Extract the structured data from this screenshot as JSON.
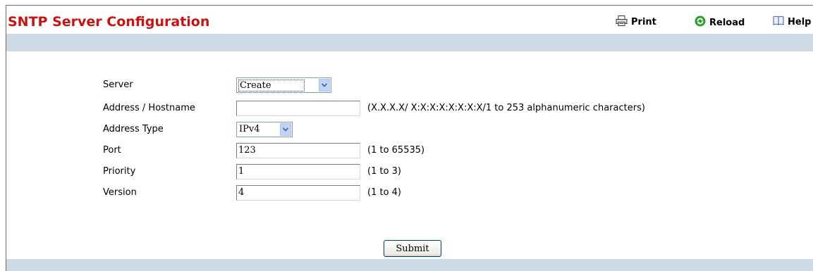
{
  "page": {
    "title": "SNTP Server Configuration"
  },
  "toolbar": {
    "print_label": "Print",
    "reload_label": "Reload",
    "help_label": "Help"
  },
  "form": {
    "server": {
      "label": "Server",
      "value": "Create"
    },
    "address": {
      "label": "Address / Hostname",
      "value": "",
      "hint": "(X.X.X.X/ X:X:X:X:X:X:X:X/1 to 253 alphanumeric characters)"
    },
    "address_type": {
      "label": "Address Type",
      "value": "IPv4"
    },
    "port": {
      "label": "Port",
      "value": "123",
      "hint": "(1 to 65535)"
    },
    "priority": {
      "label": "Priority",
      "value": "1",
      "hint": "(1 to 3)"
    },
    "version": {
      "label": "Version",
      "value": "4",
      "hint": "(1 to 4)"
    }
  },
  "actions": {
    "submit_label": "Submit"
  },
  "colors": {
    "title": "#cc1111",
    "band": "#cfdbe4",
    "reload_icon": "#2e9c2e"
  },
  "icons": [
    "printer-icon",
    "reload-icon",
    "help-book-icon",
    "chevron-down-icon"
  ]
}
